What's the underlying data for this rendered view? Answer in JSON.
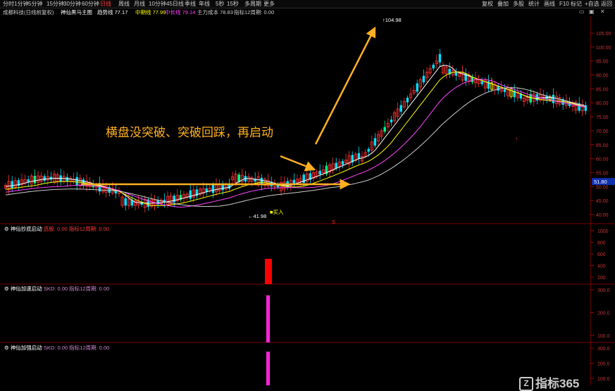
{
  "toolbar": {
    "items": [
      "分时",
      "1分钟",
      "5分钟",
      "15分钟",
      "30分钟",
      "60分钟",
      "日线",
      "周线",
      "月线",
      "10分钟",
      "45日线",
      "季线",
      "年线",
      "5秒",
      "15秒",
      "多周期",
      "更多"
    ],
    "active_index": 6,
    "right_items": [
      "复权",
      "叠加",
      "多股",
      "统计",
      "画线",
      "F10",
      "标记",
      "+自选",
      "返回"
    ]
  },
  "header": {
    "stock": "成都科技(日线前复权)",
    "indicator_name": "神仙黑马主图",
    "values": [
      {
        "label": "趋势线",
        "value": "77.17",
        "color": "#ffffff"
      },
      {
        "label": "中期线",
        "value": "77.99",
        "color": "#ffff00"
      },
      {
        "label": "中长线",
        "value": "79.14",
        "color": "#ff44ff"
      },
      {
        "label": "主力成本",
        "value": "78.83",
        "color": "#cccccc"
      },
      {
        "label": "指标12周期",
        "value": "0.00",
        "color": "#cccccc"
      }
    ]
  },
  "price_axis": {
    "ticks": [
      "105.00",
      "100.00",
      "95.00",
      "90.00",
      "85.00",
      "80.00",
      "75.00",
      "70.00",
      "65.00",
      "60.00",
      "55.00",
      "50.00",
      "45.00",
      "40.00"
    ],
    "current": "51.80"
  },
  "labels": {
    "high_price": "104.98",
    "low_price": "41.98",
    "buy": "买入",
    "down_marker": "S"
  },
  "annotation": "横盘没突破、突破回踩，再启动",
  "panels": [
    {
      "name": "神仙抄底启动",
      "values": "选股: 0.00  指标12周期: 0.00",
      "ticks": [
        "1000",
        "800",
        "600",
        "400",
        "200"
      ]
    },
    {
      "name": "神仙加速启动",
      "values": "SKD: 0.00  指标12周期: 0.00",
      "ticks": [
        "300.0",
        "200.0",
        "100.0"
      ]
    },
    {
      "name": "神仙加强启动",
      "values": "SKD: 0.00  指标12周期: 0.00",
      "ticks": [
        "300.0",
        "200.0",
        "100.0"
      ]
    }
  ],
  "watermark": {
    "brand": "指标365"
  },
  "colors": {
    "up": "#ff3232",
    "down": "#00e0ff",
    "accent": "#ffb020",
    "volume": "#ff0000",
    "magenta": "#ff22dd"
  }
}
